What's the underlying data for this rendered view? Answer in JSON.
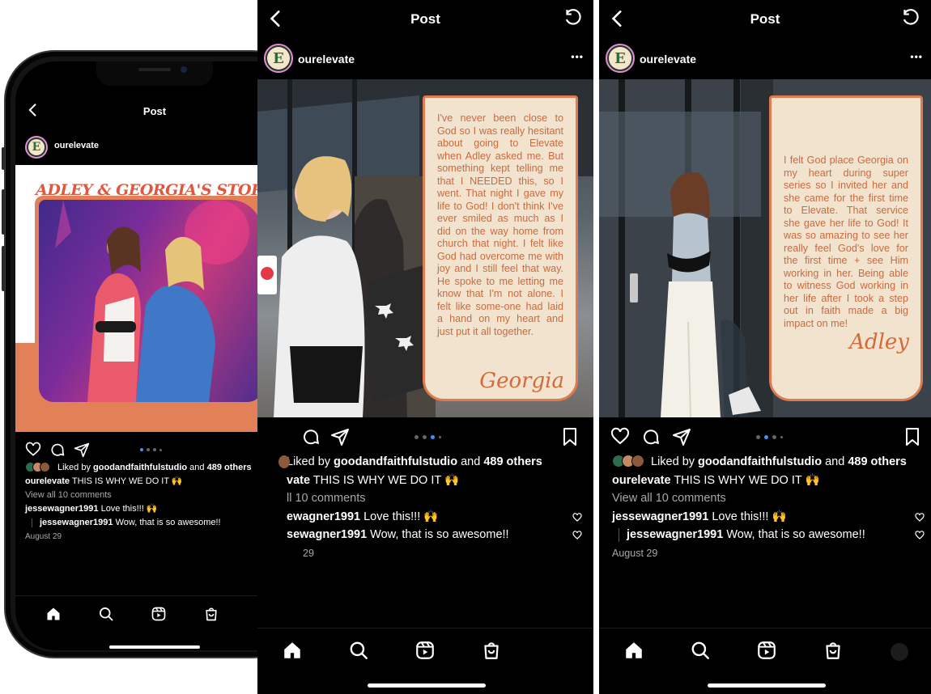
{
  "post": {
    "header_title": "Post",
    "username": "ourelevate",
    "more_label": "•••",
    "liked_by_prefix": "Liked by ",
    "liked_by_user": "goodandfaithfulstudio",
    "liked_by_and": " and ",
    "liked_by_count": "489 others",
    "caption_user": "ourelevate",
    "caption_text": " THIS IS WHY WE DO IT 🙌",
    "view_comments": "View all 10 comments",
    "comments": [
      {
        "user": "jessewagner1991",
        "text": " Love this!!! 🙌"
      },
      {
        "user": "jessewagner1991",
        "text": " Wow, that is so awesome!!"
      }
    ],
    "date": "August 29"
  },
  "slide1": {
    "story_title": "ADLEY & GEORGIA'S STORY"
  },
  "slide2": {
    "quote": "I've never been close to God so I was really hesitant about going to Elevate when Adley asked me. But something kept telling me that I NEEDED this, so I went. That night I gave my life to God! I don't think I've ever smiled as much as I did on the way home from church that night. I felt like God had overcome me with joy and I still feel that way. He spoke to me letting me know that I'm not alone. I felt like some-one had laid a hand on my heart and just put it all together.",
    "signature": "Georgia",
    "visible_caption_user": "vate",
    "visible_view_comments": "ll 10 comments",
    "visible_comment_user_1": "ewagner1991",
    "visible_comment_user_2": "sewagner1991",
    "visible_date": "29"
  },
  "slide3": {
    "quote": "I felt God place Georgia on my heart during super series so I invited her and she came for the first time to Elevate. That service she gave her life to God! It was so amazing to see her really feel God's love for the first time + see Him working in her. Being able to witness God working in her life after I took a step out in faith made a big impact on me!",
    "signature": "Adley"
  },
  "colors": {
    "accent_orange": "#e07a4f",
    "card_bg": "#f2e3cf",
    "dot_active": "#3897f0"
  },
  "carousel": {
    "slide_count": 4,
    "active_index_phone": 0,
    "active_index_middle": 2,
    "active_index_right": 1
  }
}
